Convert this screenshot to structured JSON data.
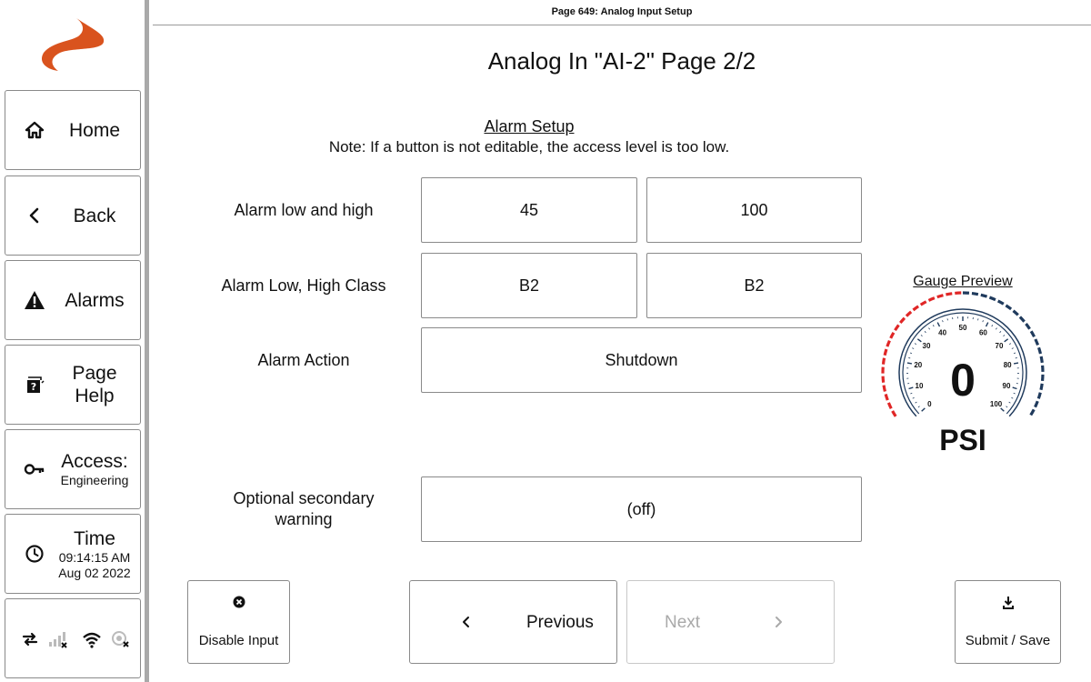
{
  "page_id": "Page 649: Analog Input Setup",
  "page_title": "Analog In \"AI-2\" Page 2/2",
  "section_heading": "Alarm Setup",
  "access_note": "Note: If a button is not editable, the access level is too low.",
  "sidebar": {
    "home": "Home",
    "back": "Back",
    "alarms": "Alarms",
    "page_help": [
      "Page",
      "Help"
    ],
    "access": {
      "label": "Access:",
      "level": "Engineering"
    },
    "time": {
      "label": "Time",
      "clock": "09:14:15 AM",
      "date": "Aug 02 2022"
    },
    "status_icons": [
      "transfer-icon",
      "cell-signal-off-icon",
      "wifi-icon",
      "gps-off-icon"
    ]
  },
  "rows": {
    "alarm_low_high": {
      "label": "Alarm low and high",
      "low": "45",
      "high": "100"
    },
    "alarm_class": {
      "label": "Alarm Low, High Class",
      "low": "B2",
      "high": "B2"
    },
    "alarm_action": {
      "label": "Alarm Action",
      "value": "Shutdown"
    },
    "secondary_warning": {
      "label": [
        "Optional secondary",
        "warning"
      ],
      "value": "(off)"
    }
  },
  "gauge": {
    "title": "Gauge Preview",
    "value": "0",
    "unit": "PSI",
    "ticks": [
      "0",
      "10",
      "20",
      "30",
      "40",
      "50",
      "60",
      "70",
      "80",
      "90",
      "100"
    ],
    "range": [
      0,
      100
    ],
    "low_zone_color": "#e02626",
    "high_zone_color": "#1f3a5c"
  },
  "bottom": {
    "disable_input": "Disable Input",
    "previous": "Previous",
    "next": "Next",
    "submit": "Submit / Save"
  },
  "colors": {
    "logo": "#d9531e",
    "border": "#8a8a8a",
    "disabled": "#a9a9a9"
  }
}
